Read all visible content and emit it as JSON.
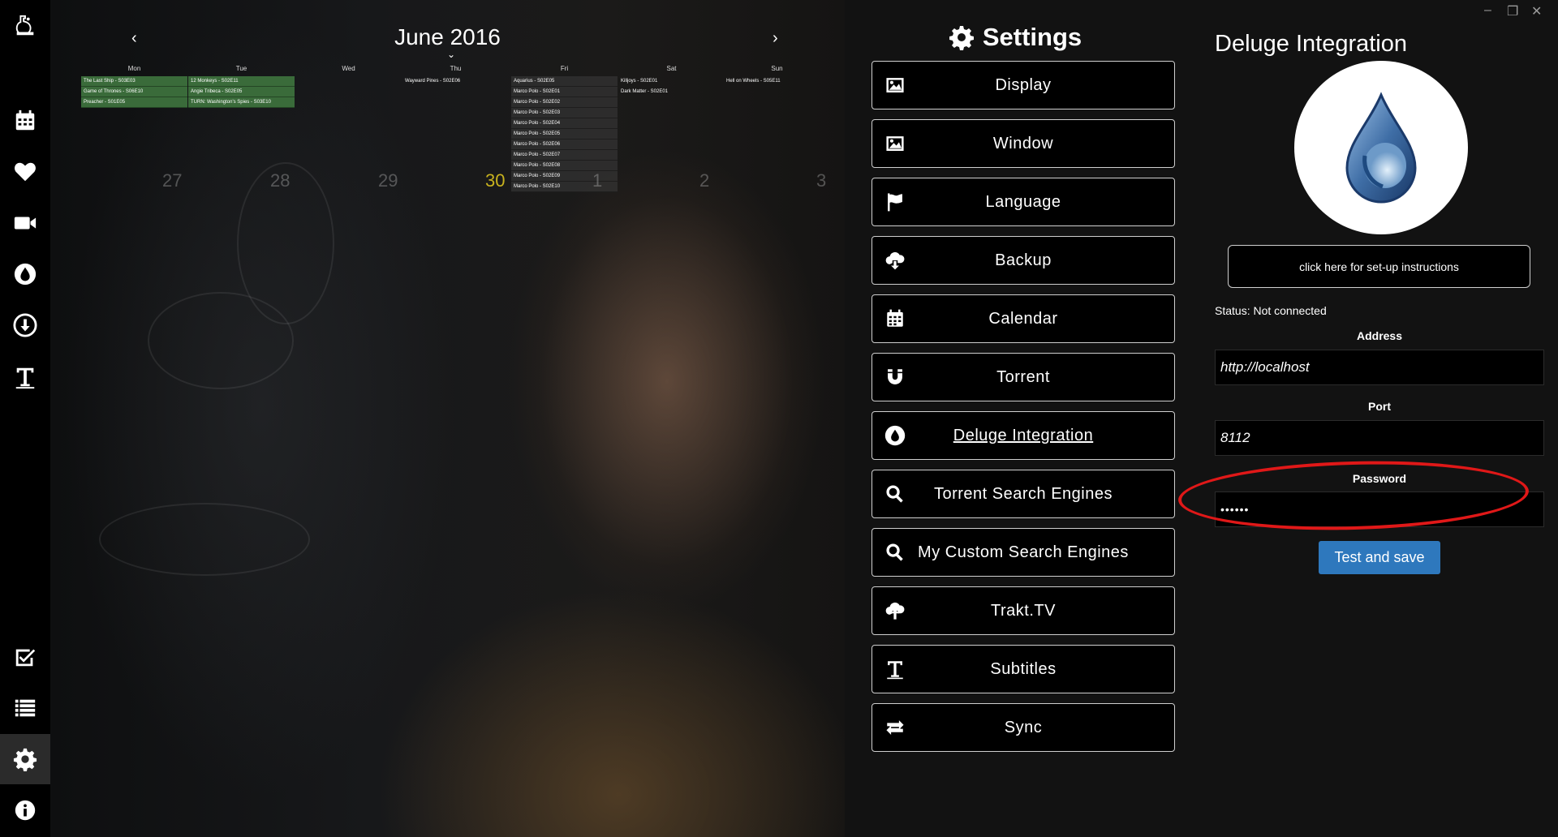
{
  "sidebar": {
    "items": [
      {
        "name": "app-logo-icon"
      },
      {
        "name": "calendar-icon"
      },
      {
        "name": "heart-icon"
      },
      {
        "name": "video-camera-icon"
      },
      {
        "name": "deluge-drop-icon"
      },
      {
        "name": "download-icon"
      },
      {
        "name": "text-t-icon"
      },
      {
        "name": "checklist-icon"
      },
      {
        "name": "list-icon"
      },
      {
        "name": "gear-icon"
      },
      {
        "name": "info-icon"
      }
    ],
    "active": "gear-icon"
  },
  "calendar": {
    "title": "June 2016",
    "prev_arrow": "‹",
    "next_arrow": "›",
    "caret": "⌄",
    "days": [
      {
        "name": "Mon",
        "events": [
          "The Last Ship - S03E03",
          "Game of Thrones - S06E10",
          "Preacher - S01E05"
        ],
        "style": "green",
        "number": "27"
      },
      {
        "name": "Tue",
        "events": [
          "12 Monkeys - S02E11",
          "Angie Tribeca - S02E05",
          "TURN: Washington's Spies - S03E10"
        ],
        "style": "green",
        "number": "28"
      },
      {
        "name": "Wed",
        "events": [],
        "style": "plain",
        "number": "29"
      },
      {
        "name": "Thu",
        "events": [
          "Wayward Pines - S02E06"
        ],
        "style": "plain",
        "number": "30"
      },
      {
        "name": "Fri",
        "events": [
          "Aquarius - S02E05",
          "Marco Polo - S02E01",
          "Marco Polo - S02E02",
          "Marco Polo - S02E03",
          "Marco Polo - S02E04",
          "Marco Polo - S02E05",
          "Marco Polo - S02E06",
          "Marco Polo - S02E07",
          "Marco Polo - S02E08",
          "Marco Polo - S02E09",
          "Marco Polo - S02E10"
        ],
        "style": "dark",
        "number": "1"
      },
      {
        "name": "Sat",
        "events": [
          "Killjoys - S02E01",
          "Dark Matter - S02E01"
        ],
        "style": "plain",
        "number": "2"
      },
      {
        "name": "Sun",
        "events": [
          "Hell on Wheels - S05E11"
        ],
        "style": "plain",
        "number": "3"
      }
    ],
    "today": "30"
  },
  "settings": {
    "title": "Settings",
    "buttons": [
      {
        "label": "Display",
        "icon": "image-icon"
      },
      {
        "label": "Window",
        "icon": "image-icon"
      },
      {
        "label": "Language",
        "icon": "flag-icon"
      },
      {
        "label": "Backup",
        "icon": "cloud-download-icon"
      },
      {
        "label": "Calendar",
        "icon": "calendar-icon"
      },
      {
        "label": "Torrent",
        "icon": "magnet-icon"
      },
      {
        "label": "Deluge Integration",
        "icon": "deluge-drop-icon"
      },
      {
        "label": "Torrent Search Engines",
        "icon": "search-icon"
      },
      {
        "label": "My Custom Search Engines",
        "icon": "search-icon"
      },
      {
        "label": "Trakt.TV",
        "icon": "cloud-upload-icon"
      },
      {
        "label": "Subtitles",
        "icon": "text-t-icon"
      },
      {
        "label": "Sync",
        "icon": "sync-icon"
      }
    ],
    "active": "Deluge Integration"
  },
  "window_controls": {
    "minimize": "–",
    "restore": "❐",
    "close": "✕"
  },
  "deluge": {
    "title": "Deluge Integration",
    "setup_button": "click here for set-up instructions",
    "status": "Status: Not connected",
    "address_label": "Address",
    "address_value": "http://localhost",
    "port_label": "Port",
    "port_value": "8112",
    "password_label": "Password",
    "password_value": "••••••",
    "submit_label": "Test and save"
  },
  "annotation": {
    "color": "#e01818"
  }
}
